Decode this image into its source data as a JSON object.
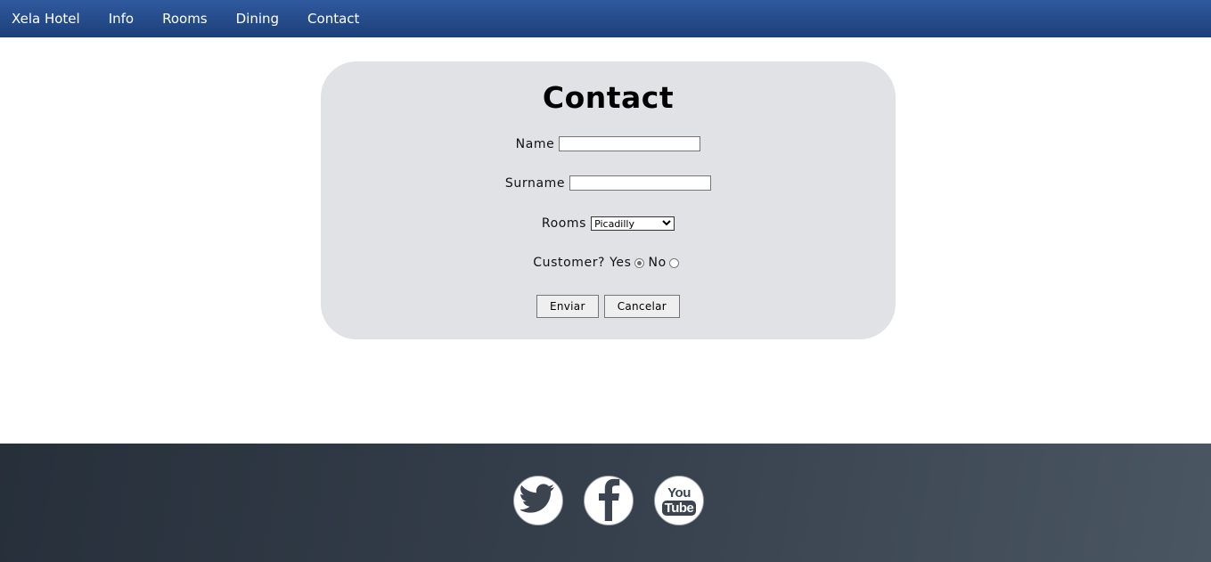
{
  "nav": {
    "items": [
      {
        "label": "Xela Hotel"
      },
      {
        "label": "Info"
      },
      {
        "label": "Rooms"
      },
      {
        "label": "Dining"
      },
      {
        "label": "Contact"
      }
    ]
  },
  "form": {
    "title": "Contact",
    "name_label": "Name",
    "name_value": "",
    "surname_label": "Surname",
    "surname_value": "",
    "rooms_label": "Rooms",
    "rooms_selected": "Picadilly",
    "customer_label": "Customer?",
    "yes_label": "Yes",
    "no_label": "No",
    "submit_label": "Enviar",
    "cancel_label": "Cancelar"
  },
  "footer": {
    "icons": [
      "twitter-icon",
      "facebook-icon",
      "youtube-icon"
    ],
    "youtube_text_top": "You",
    "youtube_text_bottom": "Tube"
  },
  "colors": {
    "nav_bg": "#2a5090",
    "panel_bg": "#e1e2e5",
    "footer_bg": "#333c47"
  }
}
